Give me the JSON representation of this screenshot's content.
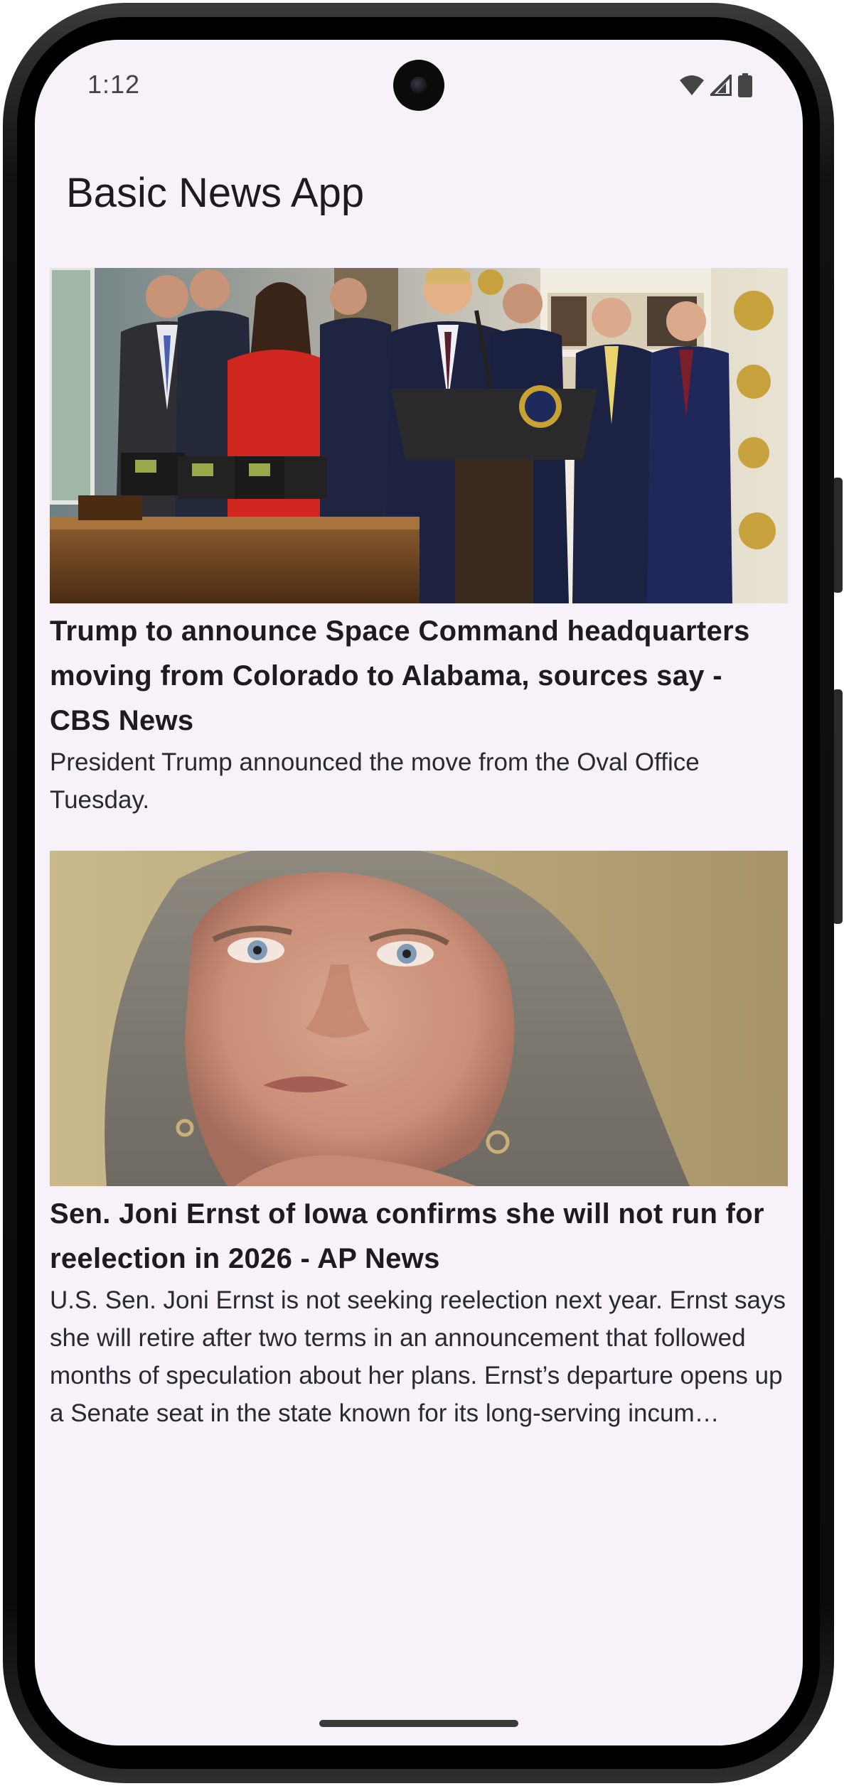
{
  "status_bar": {
    "time": "1:12",
    "icons": [
      "wifi-icon",
      "signal-icon",
      "battery-icon"
    ]
  },
  "app_bar": {
    "title": "Basic News App"
  },
  "articles": [
    {
      "title": "Trump to announce Space Command headquarters moving from Colorado to Alabama, sources say - CBS News",
      "description": "President Trump announced the move from the Oval Office Tuesday.",
      "image": "photo-of-president-at-podium-with-officials"
    },
    {
      "title": "Sen. Joni Ernst of Iowa confirms she will not run for reelection in 2026 - AP News",
      "description": "U.S. Sen. Joni Ernst is not seeking reelection next year. Ernst says she will retire after two terms in an announcement that followed months of speculation about her plans. Ernst’s departure opens up a Senate seat in the state known for its long-serving incum…",
      "image": "close-up-portrait-of-senator"
    }
  ],
  "colors": {
    "screen_background": "#f7f2fa",
    "title_text": "#1d1b20",
    "body_text": "#2b2930"
  }
}
